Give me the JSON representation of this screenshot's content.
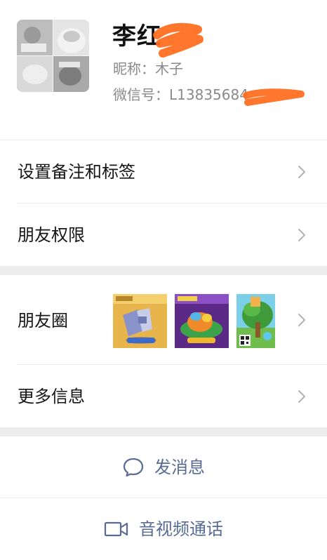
{
  "profile": {
    "name": "李红",
    "nickname": "昵称：木子",
    "wechat_id": "微信号：L13835684"
  },
  "menu": {
    "remark_label": "设置备注和标签",
    "permission_label": "朋友权限",
    "moments_label": "朋友圈",
    "more_label": "更多信息"
  },
  "actions": {
    "message_label": "发消息",
    "video_call_label": "音视频通话"
  },
  "colors": {
    "accent": "#576b95",
    "scribble": "#ff6a1a",
    "divider": "#ededed"
  }
}
